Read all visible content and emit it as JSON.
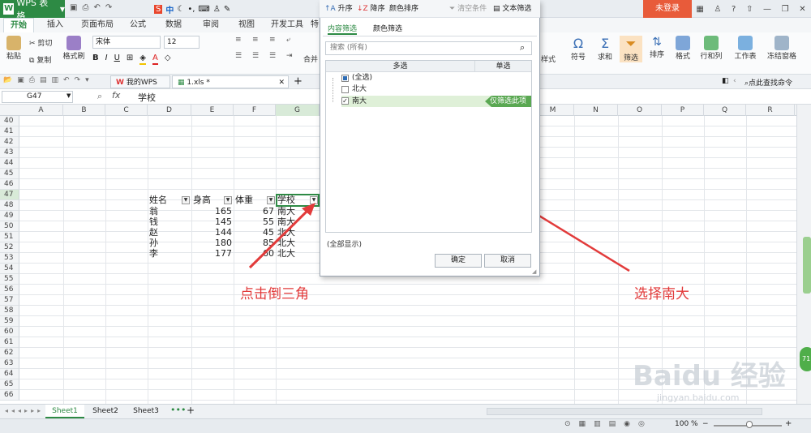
{
  "app": {
    "title": "WPS 表格",
    "login": "未登录"
  },
  "menu": [
    "开始",
    "插入",
    "页面布局",
    "公式",
    "数据",
    "审阅",
    "视图",
    "开发工具",
    "特"
  ],
  "ribbon_left": {
    "paste": "粘贴",
    "cut": "剪切",
    "copy": "复制",
    "format_painter": "格式刷",
    "font": "宋体",
    "size": "12",
    "merge": "合并"
  },
  "ribbon_right": [
    "样式",
    "符号",
    "求和",
    "筛选",
    "排序",
    "格式",
    "行和列",
    "工作表",
    "冻结窗格"
  ],
  "doc_tabs": {
    "mywps": "我的WPS",
    "file": "1.xls *",
    "find_cmd": "点此查找命令"
  },
  "formula": {
    "cell": "G47",
    "fx": "fx",
    "content": "学校"
  },
  "columns": [
    "A",
    "B",
    "C",
    "D",
    "E",
    "F",
    "G",
    "M",
    "N",
    "O",
    "P",
    "Q",
    "R"
  ],
  "rows": [
    "40",
    "41",
    "42",
    "43",
    "44",
    "45",
    "46",
    "47",
    "48",
    "49",
    "50",
    "51",
    "52",
    "53",
    "54",
    "55",
    "56",
    "57",
    "58",
    "59",
    "60",
    "61",
    "62",
    "63",
    "64",
    "65",
    "66"
  ],
  "table": {
    "headers": [
      "姓名",
      "身高",
      "体重",
      "学校"
    ],
    "rows": [
      {
        "name": "翁",
        "height": "165",
        "weight": "67",
        "school": "南大"
      },
      {
        "name": "钱",
        "height": "145",
        "weight": "55",
        "school": "南大"
      },
      {
        "name": "赵",
        "height": "144",
        "weight": "45",
        "school": "北大"
      },
      {
        "name": "孙",
        "height": "180",
        "weight": "85",
        "school": "北大"
      },
      {
        "name": "李",
        "height": "177",
        "weight": "60",
        "school": "北大"
      }
    ]
  },
  "sheets": [
    "Sheet1",
    "Sheet2",
    "Sheet3"
  ],
  "status": {
    "zoom": "100 %"
  },
  "filter": {
    "sort_asc": "升序",
    "sort_desc": "降序",
    "color_sort": "颜色排序",
    "clear": "清空条件",
    "text_filter": "文本筛选",
    "tab_content": "内容筛选",
    "tab_color": "颜色筛选",
    "search_placeholder": "搜索 (所有)",
    "col_multi": "多选",
    "col_single": "单选",
    "items": [
      {
        "label": "(全选)",
        "state": "partial"
      },
      {
        "label": "北大",
        "state": "unchecked"
      },
      {
        "label": "南大",
        "state": "checked"
      }
    ],
    "only_this": "仅筛选此项",
    "all_shown": "(全部显示)",
    "ok": "确定",
    "cancel": "取消"
  },
  "annotations": {
    "left": "点击倒三角",
    "right": "选择南大"
  },
  "watermark": {
    "brand": "Baidu 经验",
    "url": "jingyan.baidu.com"
  },
  "colors": {
    "wps_green": "#2d8a44",
    "login_orange": "#e85b3a",
    "annotation_red": "#e23b3b",
    "select_green": "#5aa852"
  }
}
